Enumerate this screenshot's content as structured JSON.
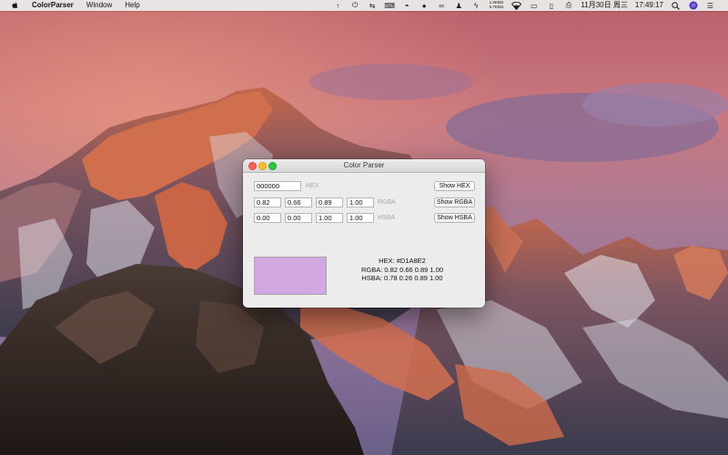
{
  "menubar": {
    "app_name": "ColorParser",
    "menus": [
      "Window",
      "Help"
    ],
    "network_up": "1.5KB/s",
    "network_down": "6.7KB/s",
    "date": "11月30日 周三",
    "time": "17:49:17"
  },
  "window": {
    "title": "Color Parser",
    "hex": {
      "value": "000000",
      "label": "HEX",
      "button": "Show HEX"
    },
    "rgba": {
      "values": [
        "0.82",
        "0.66",
        "0.89",
        "1.00"
      ],
      "label": "RGBA",
      "button": "Show RGBA"
    },
    "hsba": {
      "values": [
        "0.00",
        "0.00",
        "1.00",
        "1.00"
      ],
      "label": "HSBA",
      "button": "Show HSBA"
    },
    "swatch_color": "#D1A8E2",
    "result": {
      "hex": "HEX: #D1A8E2",
      "rgba": "RGBA: 0.82 0.66 0.89 1.00",
      "hsba": "HSBA: 0.78 0.26 0.89 1.00"
    }
  }
}
